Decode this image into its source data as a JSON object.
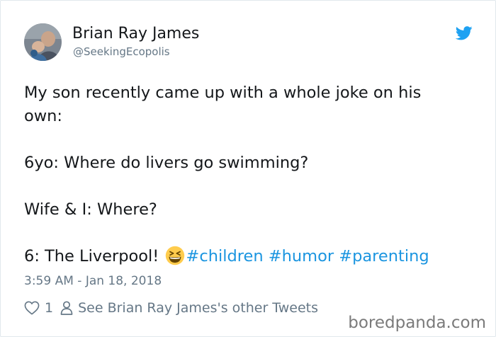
{
  "author": {
    "display_name": "Brian Ray James",
    "handle": "@SeekingEcopolis",
    "avatar_icon": "user-avatar-photo"
  },
  "brand": {
    "icon": "twitter-bird-icon",
    "color": "#1da1f2"
  },
  "tweet": {
    "lines": [
      "My son recently came up with a whole joke on his",
      "own:",
      "6yo: Where do livers go swimming?",
      "Wife & I: Where?",
      "6: The Liverpool!"
    ],
    "emoji": "grinning-squinting-face-emoji",
    "hashtags": [
      "#children",
      "#humor",
      "#parenting"
    ],
    "hashtag_color": "#1b95e0"
  },
  "timestamp": "3:59 AM - Jan 18, 2018",
  "actions": {
    "like_count": "1",
    "other_tweets_label": "See Brian Ray James's other Tweets"
  },
  "watermark": "boredpanda.com"
}
